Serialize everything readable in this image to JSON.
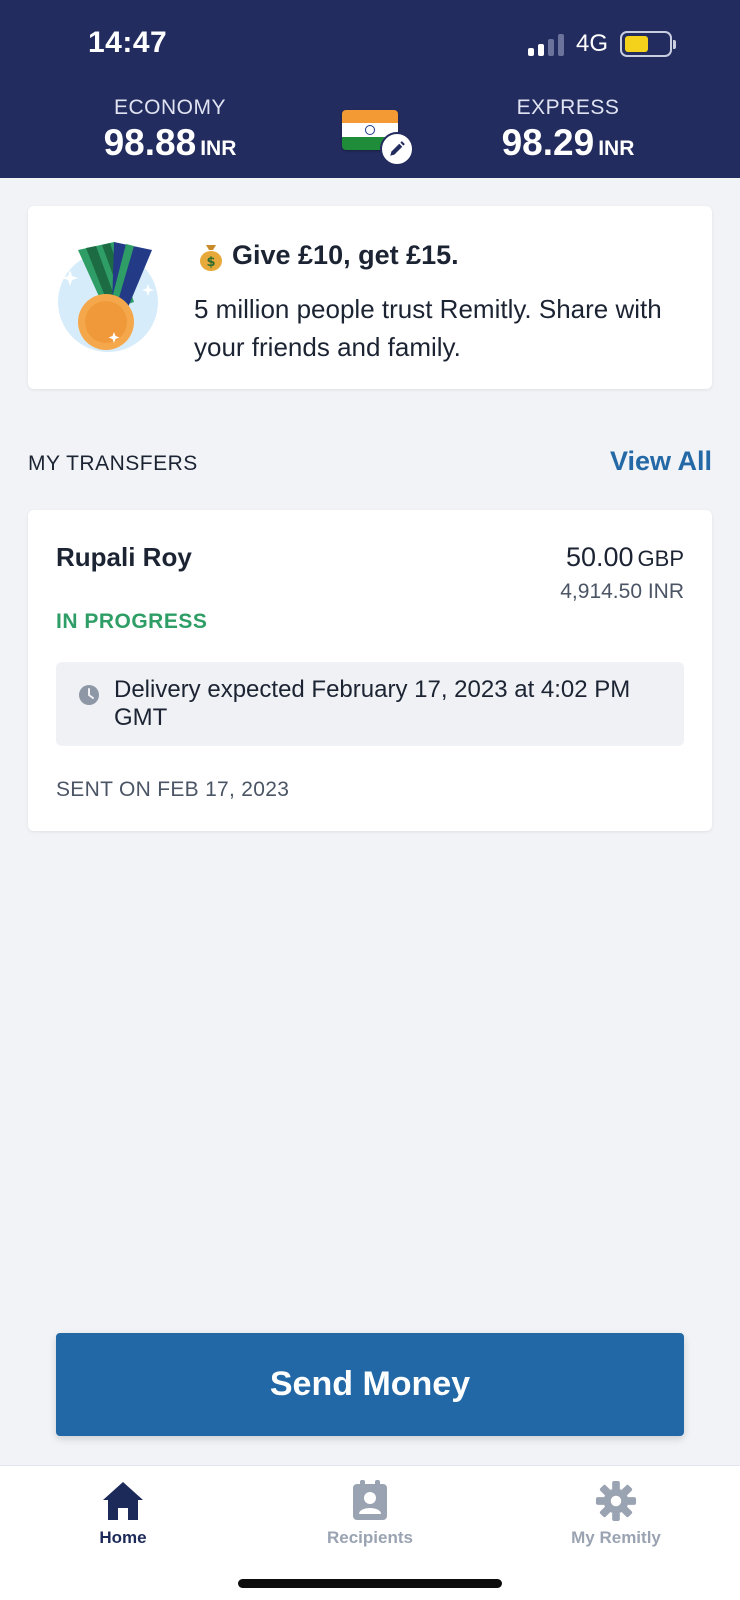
{
  "status_bar": {
    "time": "14:47",
    "network": "4G"
  },
  "rates": {
    "economy": {
      "label": "ECONOMY",
      "value": "98.88",
      "currency": "INR"
    },
    "express": {
      "label": "EXPRESS",
      "value": "98.29",
      "currency": "INR"
    }
  },
  "promo": {
    "title": "Give £10, get £15.",
    "body": "5 million people trust Remitly. Share with your friends and family."
  },
  "transfers_section": {
    "title": "MY TRANSFERS",
    "view_all": "View All"
  },
  "transfer": {
    "recipient": "Rupali Roy",
    "amount": "50.00",
    "amount_currency": "GBP",
    "converted": "4,914.50 INR",
    "status": "IN PROGRESS",
    "delivery": "Delivery expected February 17, 2023 at 4:02 PM GMT",
    "sent_on": "SENT ON FEB 17, 2023"
  },
  "send_button": "Send Money",
  "tabs": [
    {
      "label": "Home",
      "icon": "home-icon",
      "active": true
    },
    {
      "label": "Recipients",
      "icon": "contact-card-icon",
      "active": false
    },
    {
      "label": "My Remitly",
      "icon": "gear-icon",
      "active": false
    }
  ],
  "colors": {
    "header": "#232c5e",
    "accent": "#2268a6",
    "status_green": "#2e9e66",
    "battery": "#f4d21c"
  }
}
